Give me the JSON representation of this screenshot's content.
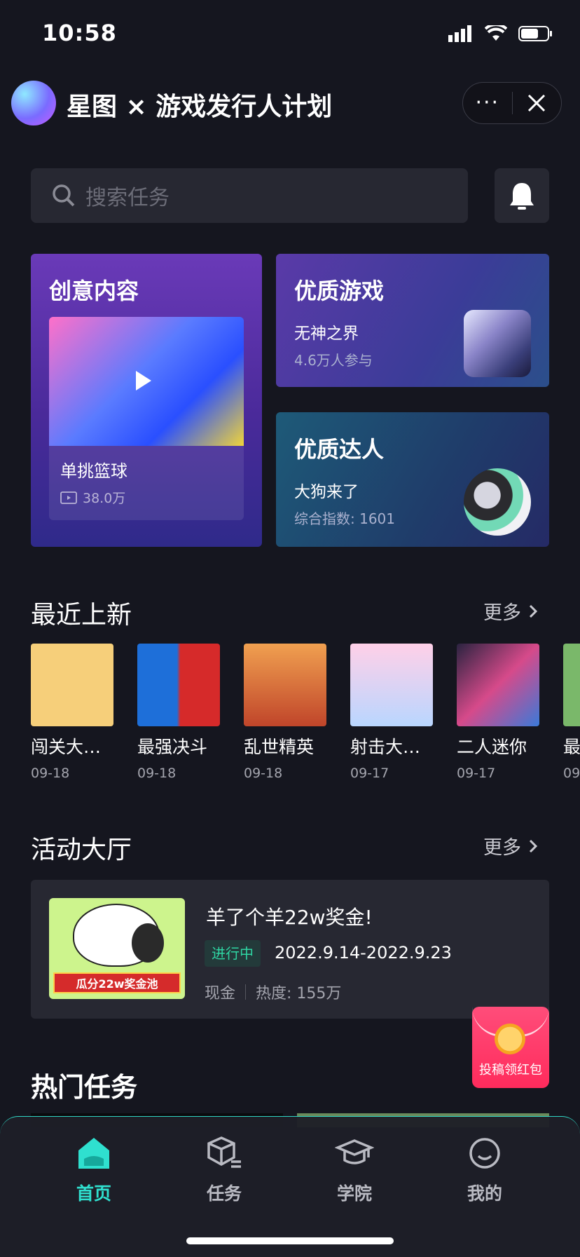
{
  "status_bar": {
    "time": "10:58"
  },
  "header": {
    "title": "星图 × 游戏发行人计划",
    "more_label": "···"
  },
  "search": {
    "placeholder": "搜索任务"
  },
  "features": {
    "creative": {
      "title": "创意内容",
      "name": "单挑篮球",
      "count": "38.0万"
    },
    "game": {
      "title": "优质游戏",
      "name": "无神之界",
      "sub": "4.6万人参与"
    },
    "creator": {
      "title": "优质达人",
      "name": "大狗来了",
      "sub": "综合指数: 1601"
    }
  },
  "recent": {
    "title": "最近上新",
    "more": "更多",
    "items": [
      {
        "name": "闯关大…",
        "date": "09-18",
        "color": "#f6cf7a"
      },
      {
        "name": "最强决斗",
        "date": "09-18",
        "color": "#d62a2a"
      },
      {
        "name": "乱世精英",
        "date": "09-18",
        "color": "#e07a3a"
      },
      {
        "name": "射击大…",
        "date": "09-17",
        "color": "#b9d6ff"
      },
      {
        "name": "二人迷你",
        "date": "09-17",
        "color": "#2a2340"
      },
      {
        "name": "最",
        "date": "09",
        "color": "#7ab86a"
      }
    ]
  },
  "events": {
    "title": "活动大厅",
    "more": "更多",
    "card": {
      "title": "羊了个羊22w奖金!",
      "status": "进行中",
      "dates": "2022.9.14-2022.9.23",
      "type": "现金",
      "heat": "热度: 155万",
      "banner": "瓜分22w奖金池"
    }
  },
  "redpacket": {
    "label": "投稿领红包"
  },
  "hot": {
    "title": "热门任务"
  },
  "tabs": [
    {
      "label": "首页",
      "icon": "home-icon"
    },
    {
      "label": "任务",
      "icon": "task-box-icon"
    },
    {
      "label": "学院",
      "icon": "graduation-cap-icon"
    },
    {
      "label": "我的",
      "icon": "smiley-icon"
    }
  ],
  "colors": {
    "accent": "#2fe0cf",
    "background": "#15161f",
    "panel": "#272832",
    "red": "#ff2b5c"
  }
}
